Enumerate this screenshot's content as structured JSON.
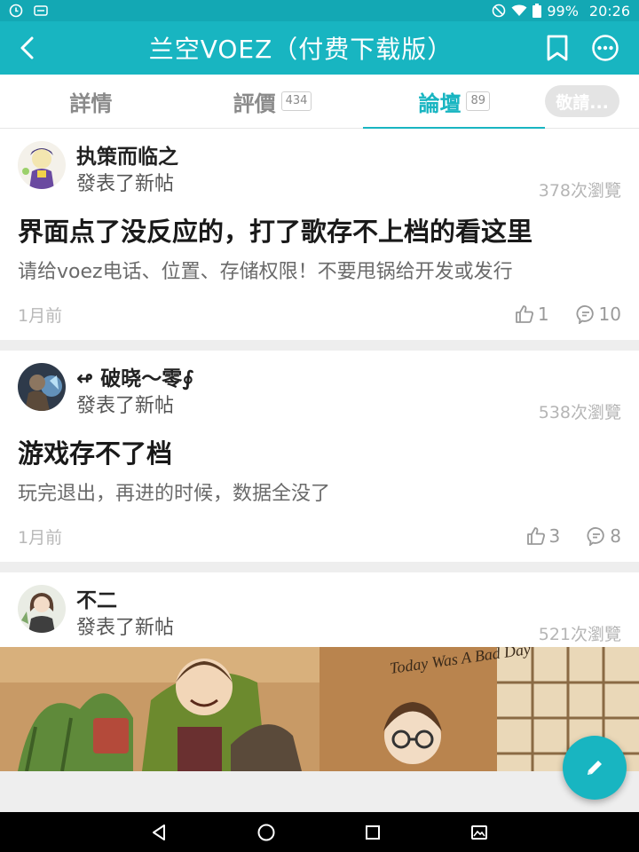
{
  "status_bar": {
    "battery": "99%",
    "time": "20:26",
    "icons": [
      "clock-icon",
      "notification-icon",
      "dnd-icon",
      "wifi-icon",
      "battery-icon"
    ]
  },
  "app_bar": {
    "title": "兰空VOEZ（付费下载版）",
    "icons": [
      "back-arrow-icon",
      "bookmark-icon",
      "more-icon"
    ]
  },
  "tabs": [
    {
      "label": "詳情",
      "badge": ""
    },
    {
      "label": "評價",
      "badge": "434"
    },
    {
      "label": "論壇",
      "badge": "89",
      "active": true
    },
    {
      "label": "敬請...",
      "badge": ""
    }
  ],
  "posts": [
    {
      "author": "执策而临之",
      "action": "發表了新帖",
      "views": "378次瀏覽",
      "title": "界面点了没反应的，打了歌存不上档的看这里",
      "excerpt": "请给voez电话、位置、存储权限！不要甩锅给开发或发行",
      "time": "1月前",
      "likes": "1",
      "comments": "10"
    },
    {
      "author": "↫ 破晓～零∮",
      "action": "發表了新帖",
      "views": "538次瀏覽",
      "title": "游戏存不了档",
      "excerpt": "玩完退出，再进的时候，数据全没了",
      "time": "1月前",
      "likes": "3",
      "comments": "8"
    },
    {
      "author": "不二",
      "action": "發表了新帖",
      "views": "521次瀏覽",
      "image_caption": "Today Was A Bad Day"
    }
  ],
  "colors": {
    "accent": "#18b5c1",
    "status_bar": "#13a8b4",
    "muted_text": "#b5b5b5",
    "separator": "#eeeeee"
  }
}
